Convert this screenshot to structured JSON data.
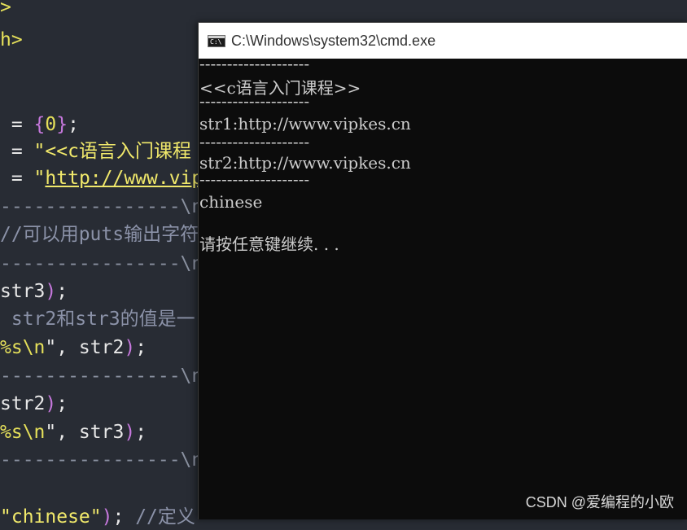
{
  "editor": {
    "lines": [
      {
        "parts": [
          {
            "c": "y",
            "t": ">"
          }
        ]
      },
      {
        "parts": [
          {
            "c": "y",
            "t": "h>"
          }
        ]
      },
      {
        "parts": []
      },
      {
        "parts": []
      },
      {
        "parts": [
          {
            "c": "w",
            "t": " = "
          },
          {
            "c": "p",
            "t": "{"
          },
          {
            "c": "y",
            "t": "0"
          },
          {
            "c": "p",
            "t": "}"
          },
          {
            "c": "w",
            "t": ";"
          }
        ]
      },
      {
        "parts": [
          {
            "c": "w",
            "t": " = "
          },
          {
            "c": "str",
            "t": "\"<<c语言入门课程"
          }
        ]
      },
      {
        "parts": [
          {
            "c": "w",
            "t": " = "
          },
          {
            "c": "str",
            "t": "\""
          },
          {
            "c": "strul",
            "t": "http://www.vip"
          }
        ]
      },
      {
        "parts": [
          {
            "c": "dim",
            "t": "----------------\\n"
          }
        ]
      },
      {
        "parts": [
          {
            "c": "cmt",
            "t": "//可以用puts输出字符"
          }
        ]
      },
      {
        "parts": [
          {
            "c": "dim",
            "t": "----------------\\n"
          }
        ]
      },
      {
        "parts": [
          {
            "c": "w",
            "t": "str3"
          },
          {
            "c": "p",
            "t": ")"
          },
          {
            "c": "w",
            "t": ";"
          }
        ]
      },
      {
        "parts": [
          {
            "c": "cmt",
            "t": " str2和str3的值是一"
          }
        ]
      },
      {
        "parts": [
          {
            "c": "y",
            "t": "%s\\n"
          },
          {
            "c": "w",
            "t": "\", str2"
          },
          {
            "c": "p",
            "t": ")"
          },
          {
            "c": "w",
            "t": ";"
          }
        ]
      },
      {
        "parts": [
          {
            "c": "dim",
            "t": "----------------\\n"
          }
        ]
      },
      {
        "parts": [
          {
            "c": "w",
            "t": "str2"
          },
          {
            "c": "p",
            "t": ")"
          },
          {
            "c": "w",
            "t": ";"
          }
        ]
      },
      {
        "parts": [
          {
            "c": "y",
            "t": "%s\\n"
          },
          {
            "c": "w",
            "t": "\", str3"
          },
          {
            "c": "p",
            "t": ")"
          },
          {
            "c": "w",
            "t": ";"
          }
        ]
      },
      {
        "parts": [
          {
            "c": "dim",
            "t": "----------------\\n"
          }
        ]
      },
      {
        "parts": []
      },
      {
        "parts": [
          {
            "c": "str",
            "t": "\"chinese\""
          },
          {
            "c": "p",
            "t": ")"
          },
          {
            "c": "w",
            "t": "; "
          },
          {
            "c": "cmt",
            "t": "//定义"
          }
        ]
      }
    ]
  },
  "window": {
    "title": "C:\\Windows\\system32\\cmd.exe",
    "icon_text": "C:\\"
  },
  "console": {
    "lines": [
      "--------------------",
      "<<c语言入门课程>>",
      "--------------------",
      "str1:http://www.vipkes.cn",
      "--------------------",
      "str2:http://www.vipkes.cn",
      "--------------------",
      "chinese",
      "",
      "请按任意键继续. . ."
    ]
  },
  "watermark": "CSDN @爱编程的小欧"
}
